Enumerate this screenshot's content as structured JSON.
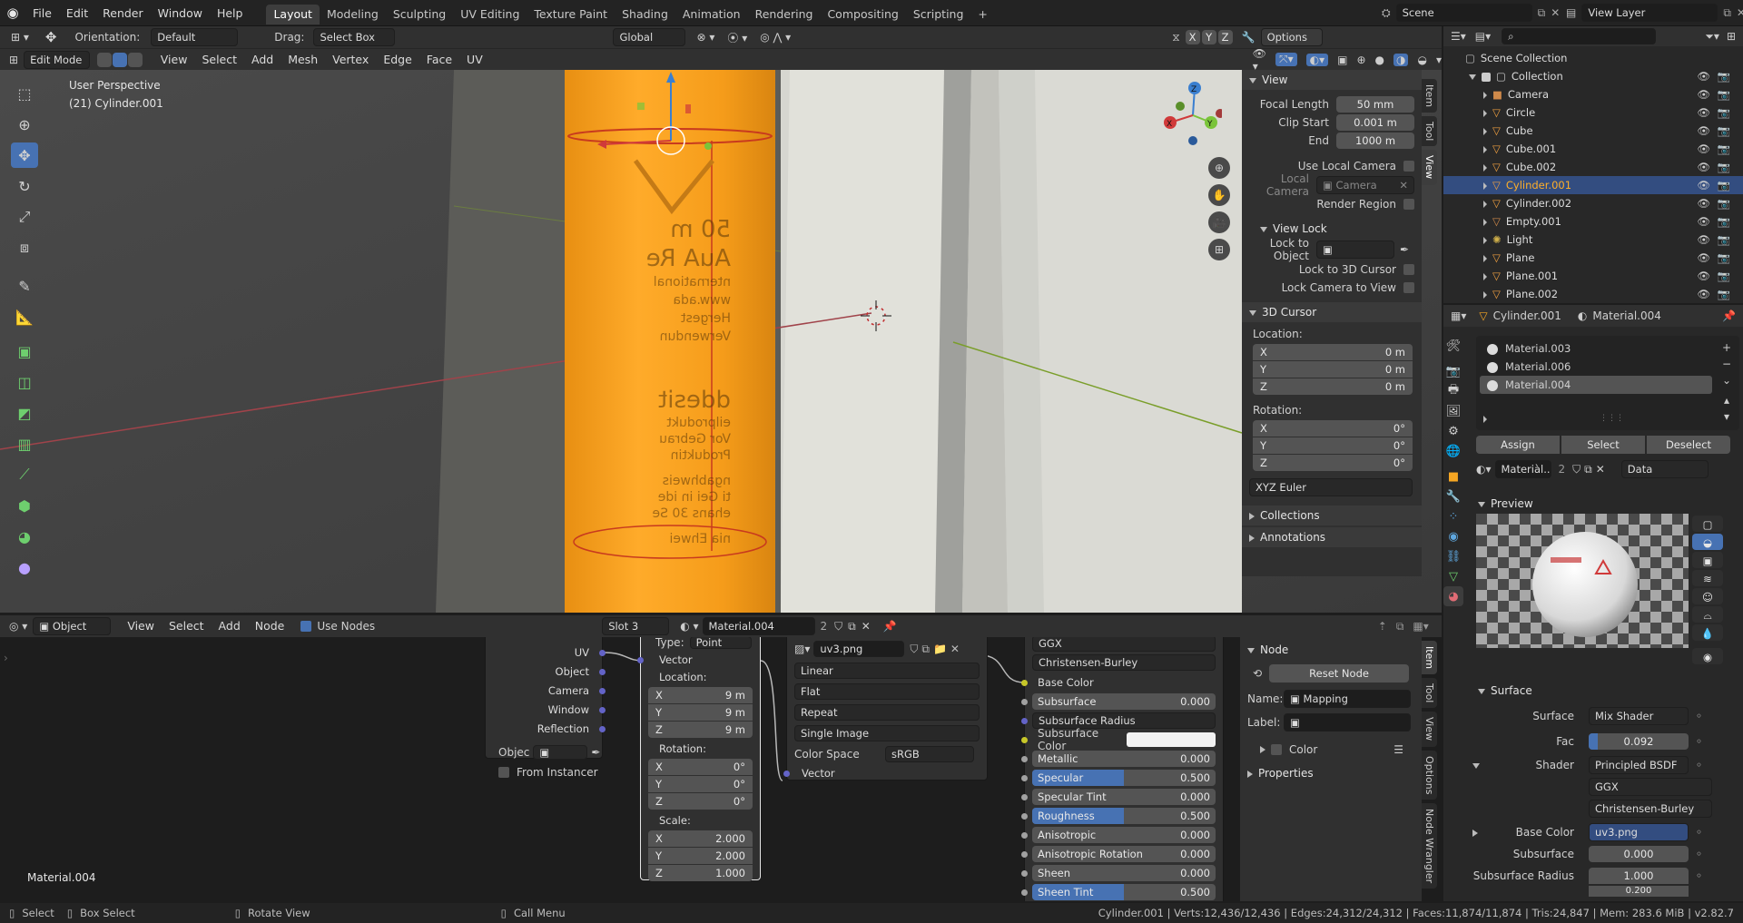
{
  "topbar": {
    "menus": [
      "File",
      "Edit",
      "Render",
      "Window",
      "Help"
    ],
    "workspaces": [
      "Layout",
      "Modeling",
      "Sculpting",
      "UV Editing",
      "Texture Paint",
      "Shading",
      "Animation",
      "Rendering",
      "Compositing",
      "Scripting"
    ],
    "active_workspace": "Layout",
    "add_tab": "+",
    "scene": "Scene",
    "view_layer": "View Layer"
  },
  "viewport_header": {
    "mode": "Edit Mode",
    "menus": [
      "View",
      "Select",
      "Add",
      "Mesh",
      "Vertex",
      "Edge",
      "Face",
      "UV"
    ],
    "orientation_label": "Orientation:",
    "orientation": "Default",
    "drag_label": "Drag:",
    "drag": "Select Box",
    "transform": "Global",
    "options": "Options",
    "axes": [
      "X",
      "Y",
      "Z"
    ]
  },
  "viewport": {
    "perspective": "User Perspective",
    "object": "(21) Cylinder.001",
    "label_lines": [
      "50 m",
      "AuA Re",
      "nternational",
      "www.ada",
      "Hergest",
      "Verwendun",
      "ddesit",
      "eilprodukt",
      "Vor Gebrau",
      "Produktin",
      "ngabhweis",
      "ti Gei in ide",
      "ehans 30 Se",
      "nia Ehwei"
    ],
    "gizmo": {
      "x": "X",
      "y": "Y",
      "z": "Z"
    }
  },
  "n_panel": {
    "view_title": "View",
    "focal_length_label": "Focal Length",
    "focal_length": "50 mm",
    "clip_start_label": "Clip Start",
    "clip_start": "0.001 m",
    "end_label": "End",
    "end": "1000 m",
    "use_local_camera": "Use Local Camera",
    "local_camera_label": "Local Camera",
    "local_camera": "Camera",
    "render_region": "Render Region",
    "view_lock_title": "View Lock",
    "lock_to_object": "Lock to Object",
    "lock_to_3d_cursor": "Lock to 3D Cursor",
    "lock_camera_to_view": "Lock Camera to View",
    "cursor_title": "3D Cursor",
    "location_label": "Location:",
    "loc": [
      {
        "axis": "X",
        "value": "0 m"
      },
      {
        "axis": "Y",
        "value": "0 m"
      },
      {
        "axis": "Z",
        "value": "0 m"
      }
    ],
    "rotation_label": "Rotation:",
    "rot": [
      {
        "axis": "X",
        "value": "0°"
      },
      {
        "axis": "Y",
        "value": "0°"
      },
      {
        "axis": "Z",
        "value": "0°"
      }
    ],
    "rotation_mode": "XYZ Euler",
    "collections": "Collections",
    "annotations": "Annotations",
    "tabs": [
      "Item",
      "Tool",
      "View"
    ]
  },
  "outliner": {
    "search_placeholder": "",
    "scene_collection": "Scene Collection",
    "collection": "Collection",
    "items": [
      "Camera",
      "Circle",
      "Cube",
      "Cube.001",
      "Cube.002",
      "Cylinder.001",
      "Cylinder.002",
      "Empty.001",
      "Light",
      "Plane",
      "Plane.001",
      "Plane.002"
    ],
    "selected": "Cylinder.001"
  },
  "properties": {
    "object": "Cylinder.001",
    "material": "Material.004",
    "slots": [
      "Material.003",
      "Material.006",
      "Material.004"
    ],
    "assign": "Assign",
    "select": "Select",
    "deselect": "Deselect",
    "material_field": "Materiàl...",
    "users": "2",
    "link": "Data",
    "preview": "Preview",
    "surface_section": "Surface",
    "surface_label": "Surface",
    "surface": "Mix Shader",
    "fac_label": "Fac",
    "fac": "0.092",
    "shader_label": "Shader",
    "shader": "Principled BSDF",
    "distribution": "GGX",
    "subsurface_method": "Christensen-Burley",
    "base_color_label": "Base Color",
    "base_color": "uv3.png",
    "subsurface_label": "Subsurface",
    "subsurface": "0.000",
    "subsurface_radius_label": "Subsurface Radius",
    "subsurface_radius": "1.000",
    "subsurface_radius_2": "0.200"
  },
  "node_editor": {
    "editor_type": "Object",
    "menus": [
      "View",
      "Select",
      "Add",
      "Node"
    ],
    "use_nodes": "Use Nodes",
    "slot": "Slot 3",
    "material": "Material.004",
    "users": "2",
    "footer_material": "Material.004",
    "texcoord": {
      "outputs": [
        "UV",
        "Object",
        "Camera",
        "Window",
        "Reflection"
      ],
      "object_label": "Objec",
      "from_instancer": "From Instancer"
    },
    "mapping": {
      "type_label": "Type:",
      "type": "Point",
      "vector": "Vector",
      "location_label": "Location:",
      "loc": [
        {
          "axis": "X",
          "value": "9 m"
        },
        {
          "axis": "Y",
          "value": "9 m"
        },
        {
          "axis": "Z",
          "value": "9 m"
        }
      ],
      "rotation_label": "Rotation:",
      "rot": [
        {
          "axis": "X",
          "value": "0°"
        },
        {
          "axis": "Y",
          "value": "0°"
        },
        {
          "axis": "Z",
          "value": "0°"
        }
      ],
      "scale_label": "Scale:",
      "scale": [
        {
          "axis": "X",
          "value": "2.000"
        },
        {
          "axis": "Y",
          "value": "2.000"
        },
        {
          "axis": "Z",
          "value": "1.000"
        }
      ]
    },
    "image_tex": {
      "image": "uv3.png",
      "interpolation": "Linear",
      "projection": "Flat",
      "extension": "Repeat",
      "source": "Single Image",
      "color_space_label": "Color Space",
      "color_space": "sRGB",
      "vector": "Vector"
    },
    "bsdf": {
      "distribution": "GGX",
      "subsurface_method": "Christensen-Burley",
      "base_color": "Base Color",
      "rows": [
        {
          "label": "Subsurface",
          "value": "0.000",
          "fill": 0
        },
        {
          "label": "Subsurface Radius",
          "value": "",
          "fill": 0
        },
        {
          "label": "Subsurface Color",
          "value": "",
          "fill": 0
        },
        {
          "label": "Metallic",
          "value": "0.000",
          "fill": 0
        },
        {
          "label": "Specular",
          "value": "0.500",
          "fill": 0.5
        },
        {
          "label": "Specular Tint",
          "value": "0.000",
          "fill": 0
        },
        {
          "label": "Roughness",
          "value": "0.500",
          "fill": 0.5
        },
        {
          "label": "Anisotropic",
          "value": "0.000",
          "fill": 0
        },
        {
          "label": "Anisotropic Rotation",
          "value": "0.000",
          "fill": 0
        },
        {
          "label": "Sheen",
          "value": "0.000",
          "fill": 0
        },
        {
          "label": "Sheen Tint",
          "value": "0.500",
          "fill": 0.5
        }
      ]
    },
    "sidebar": {
      "node_title": "Node",
      "reset_node": "Reset Node",
      "name_label": "Name:",
      "name": "Mapping",
      "label_label": "Label:",
      "label": "",
      "color": "Color",
      "properties": "Properties",
      "tabs": [
        "Item",
        "Tool",
        "View",
        "Options",
        "Node Wrangler"
      ]
    }
  },
  "statusbar": {
    "select": "Select",
    "box_select": "Box Select",
    "rotate_view": "Rotate View",
    "call_menu": "Call Menu",
    "stats": "Cylinder.001 | Verts:12,436/12,436 | Edges:24,312/24,312 | Faces:11,874/11,874 | Tris:24,847 | Mem: 283.6 MiB | v2.82.7"
  },
  "colors": {
    "accent": "#4772b3",
    "selected_orange": "#f5a623",
    "background": "#1d1d1d"
  }
}
